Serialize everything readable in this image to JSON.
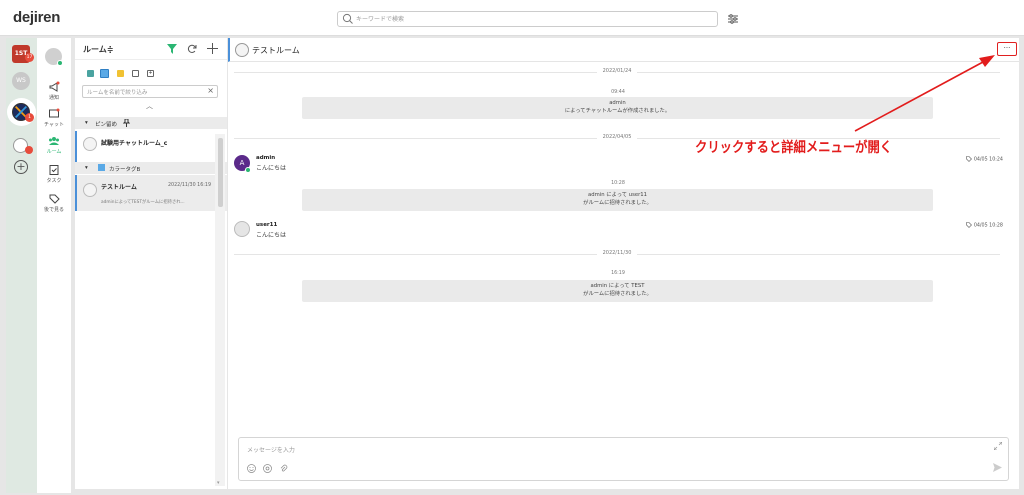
{
  "app": {
    "name": "dejiren"
  },
  "search": {
    "placeholder": "キーワードで検索"
  },
  "nav": {
    "items": [
      {
        "label": "通知"
      },
      {
        "label": "チャット"
      },
      {
        "label": "ルーム"
      },
      {
        "label": "タスク"
      },
      {
        "label": "後で見る"
      }
    ]
  },
  "workspace": {
    "badges": [
      "17",
      "1"
    ]
  },
  "rooms": {
    "header": "ルーム≑",
    "search_placeholder": "ルームを名前で絞り込み",
    "pinned_section": "ピン留め",
    "tag_section": "カラータグB",
    "items": [
      {
        "name": "試験用チャットルーム_c",
        "date": "",
        "last": ""
      },
      {
        "name": "テストルーム",
        "date": "2022/11/30 16:19",
        "last": "adminによってTESTがルームに招待され..."
      }
    ]
  },
  "chat": {
    "title": "テストルーム",
    "more_label": "···",
    "dates": [
      "2022/01/24",
      "2022/04/05",
      "2022/11/30"
    ],
    "sys1": {
      "time": "09:44",
      "line1": "admin",
      "line2": "によってチャットルームが作成されました。"
    },
    "msg1": {
      "initial": "A",
      "name": "admin",
      "text": "こんにちは",
      "meta": "04/05 10:24"
    },
    "sys2": {
      "time": "10:28",
      "line1": "admin によって user11",
      "line2": "がルームに招待されました。"
    },
    "msg2": {
      "name": "user11",
      "text": "こんにちは",
      "meta": "04/05 10:28"
    },
    "sys3": {
      "time": "16:19",
      "line1": "admin によって TEST",
      "line2": "がルームに招待されました。"
    },
    "composer_placeholder": "メッセージを入力"
  },
  "annotation": {
    "text": "クリックすると詳細メニューが開く",
    "color": "#e21c1c"
  },
  "colors": {
    "accent": "#4a90d9",
    "green": "#2bb673",
    "annotation_red": "#e21c1c"
  }
}
